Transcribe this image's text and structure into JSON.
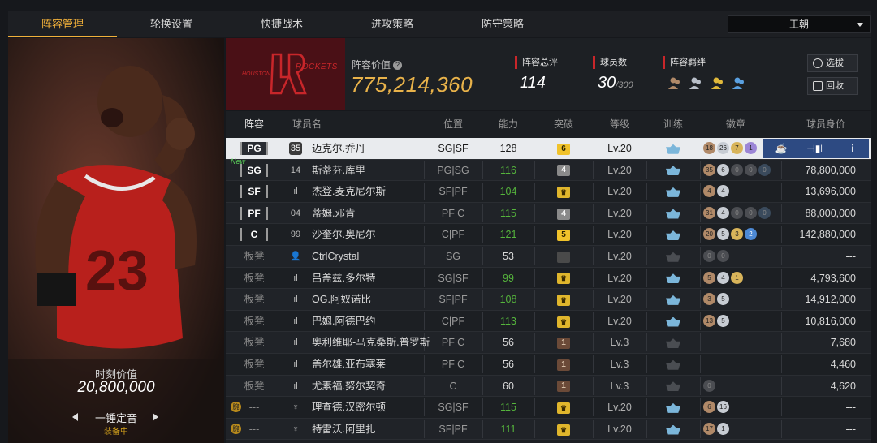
{
  "nav": {
    "tabs": [
      "阵容管理",
      "轮换设置",
      "快捷战术",
      "进攻策略",
      "防守策略"
    ],
    "active_tab": 0,
    "team_select": "王朝"
  },
  "left_panel": {
    "value_label": "时刻价值",
    "value": "20,800,000",
    "skill_name": "一锤定音",
    "skill_status": "装备中"
  },
  "header": {
    "team_logo_text": "ROCKETS",
    "lineup_value_label": "阵容价值",
    "lineup_value": "775,214,360",
    "overall_label": "阵容总评",
    "overall_value": "114",
    "player_count_label": "球员数",
    "player_count": "30",
    "player_count_max": "/300",
    "bond_label": "阵容羁绊",
    "filter_button": "选拔",
    "recycle_button": "回收"
  },
  "table": {
    "columns": [
      "阵容",
      "球员名",
      "位置",
      "能力",
      "突破",
      "等级",
      "训练",
      "徽章",
      "球员身价"
    ],
    "rows": [
      {
        "slot": "PG",
        "slot_type": "pos",
        "num": "35",
        "num_style": "hex",
        "name": "迈克尔.乔丹",
        "position": "SG|SF",
        "rating": "128",
        "rating_green": false,
        "break": "6",
        "break_style": "yellow",
        "level": "Lv.20",
        "train": true,
        "badges": [
          [
            "18",
            "b-bronze"
          ],
          [
            "26",
            "b-silver"
          ],
          [
            "7",
            "b-gold"
          ],
          [
            "1",
            "b-purple"
          ]
        ],
        "value": "",
        "selected": true
      },
      {
        "slot": "SG",
        "slot_type": "pos",
        "new": "New",
        "num": "14",
        "num_style": "plain",
        "name": "斯蒂芬.库里",
        "position": "PG|SG",
        "rating": "116",
        "rating_green": true,
        "break": "4",
        "break_style": "gray",
        "level": "Lv.20",
        "train": true,
        "badges": [
          [
            "35",
            "b-bronze"
          ],
          [
            "6",
            "b-silver"
          ],
          [
            "0",
            "b-dark"
          ],
          [
            "0",
            "b-dark"
          ],
          [
            "0",
            "b-dark2"
          ]
        ],
        "value": "78,800,000"
      },
      {
        "slot": "SF",
        "slot_type": "pos",
        "num": "ıl",
        "num_style": "plain",
        "name": "杰登.麦克尼尔斯",
        "position": "SF|PF",
        "rating": "104",
        "rating_green": true,
        "break": "♛",
        "break_style": "crown",
        "level": "Lv.20",
        "train": true,
        "badges": [
          [
            "4",
            "b-bronze"
          ],
          [
            "4",
            "b-silver"
          ]
        ],
        "value": "13,696,000"
      },
      {
        "slot": "PF",
        "slot_type": "pos",
        "num": "04",
        "num_style": "plain",
        "name": "蒂姆.邓肯",
        "position": "PF|C",
        "rating": "115",
        "rating_green": true,
        "break": "4",
        "break_style": "gray",
        "level": "Lv.20",
        "train": true,
        "badges": [
          [
            "31",
            "b-bronze"
          ],
          [
            "4",
            "b-silver"
          ],
          [
            "0",
            "b-dark"
          ],
          [
            "0",
            "b-dark"
          ],
          [
            "0",
            "b-dark2"
          ]
        ],
        "value": "88,000,000"
      },
      {
        "slot": "C",
        "slot_type": "pos",
        "num": "99",
        "num_style": "plain",
        "name": "沙奎尔.奥尼尔",
        "position": "C|PF",
        "rating": "121",
        "rating_green": true,
        "break": "5",
        "break_style": "yellow",
        "level": "Lv.20",
        "train": true,
        "badges": [
          [
            "20",
            "b-bronze"
          ],
          [
            "5",
            "b-silver"
          ],
          [
            "3",
            "b-gold"
          ],
          [
            "2",
            "b-blue"
          ]
        ],
        "value": "142,880,000"
      },
      {
        "slot": "板凳",
        "slot_type": "bench",
        "num": "👤",
        "num_style": "plain",
        "name": "CtrlCrystal",
        "position": "SG",
        "rating": "53",
        "rating_green": false,
        "break": "",
        "break_style": "dark",
        "level": "Lv.20",
        "train": false,
        "badges": [
          [
            "0",
            "b-dark"
          ],
          [
            "0",
            "b-dark"
          ]
        ],
        "value": "---"
      },
      {
        "slot": "板凳",
        "slot_type": "bench",
        "num": "ıl",
        "num_style": "plain",
        "name": "吕盖兹.多尔特",
        "position": "SG|SF",
        "rating": "99",
        "rating_green": true,
        "break": "♛",
        "break_style": "crown",
        "level": "Lv.20",
        "train": true,
        "badges": [
          [
            "5",
            "b-bronze"
          ],
          [
            "4",
            "b-silver"
          ],
          [
            "1",
            "b-gold"
          ]
        ],
        "value": "4,793,600"
      },
      {
        "slot": "板凳",
        "slot_type": "bench",
        "num": "ıl",
        "num_style": "plain",
        "name": "OG.阿奴诺比",
        "position": "SF|PF",
        "rating": "108",
        "rating_green": true,
        "break": "♛",
        "break_style": "crown",
        "level": "Lv.20",
        "train": true,
        "badges": [
          [
            "3",
            "b-bronze"
          ],
          [
            "5",
            "b-silver"
          ]
        ],
        "value": "14,912,000"
      },
      {
        "slot": "板凳",
        "slot_type": "bench",
        "num": "ıl",
        "num_style": "plain",
        "name": "巴姆.阿德巴约",
        "position": "C|PF",
        "rating": "113",
        "rating_green": true,
        "break": "♛",
        "break_style": "crown",
        "level": "Lv.20",
        "train": true,
        "badges": [
          [
            "13",
            "b-bronze"
          ],
          [
            "5",
            "b-silver"
          ]
        ],
        "value": "10,816,000"
      },
      {
        "slot": "板凳",
        "slot_type": "bench",
        "num": "ıl",
        "num_style": "plain",
        "name": "奥利维耶-马克桑斯.普罗斯",
        "position": "PF|C",
        "rating": "56",
        "rating_green": false,
        "break": "1",
        "break_style": "brown",
        "level": "Lv.3",
        "train": false,
        "badges": [],
        "value": "7,680"
      },
      {
        "slot": "板凳",
        "slot_type": "bench",
        "num": "ıl",
        "num_style": "plain",
        "name": "盖尔雄.亚布塞莱",
        "position": "PF|C",
        "rating": "56",
        "rating_green": false,
        "break": "1",
        "break_style": "brown",
        "level": "Lv.3",
        "train": false,
        "badges": [],
        "value": "4,460"
      },
      {
        "slot": "板凳",
        "slot_type": "bench",
        "num": "ıl",
        "num_style": "plain",
        "name": "尤素福.努尔契奇",
        "position": "C",
        "rating": "60",
        "rating_green": false,
        "break": "1",
        "break_style": "brown",
        "level": "Lv.3",
        "train": false,
        "badges": [
          [
            "0",
            "b-dark"
          ]
        ],
        "value": "4,620"
      },
      {
        "slot": "---",
        "slot_type": "coin",
        "num": "♆",
        "num_style": "plain",
        "name": "理查德.汉密尔顿",
        "position": "SG|SF",
        "rating": "115",
        "rating_green": true,
        "break": "♛",
        "break_style": "crown",
        "level": "Lv.20",
        "train": true,
        "badges": [
          [
            "6",
            "b-bronze"
          ],
          [
            "16",
            "b-silver"
          ]
        ],
        "value": "---"
      },
      {
        "slot": "---",
        "slot_type": "coin",
        "num": "♆",
        "num_style": "plain",
        "name": "特雷沃.阿里扎",
        "position": "SF|PF",
        "rating": "111",
        "rating_green": true,
        "break": "♛",
        "break_style": "crown",
        "level": "Lv.20",
        "train": true,
        "badges": [
          [
            "17",
            "b-bronze"
          ],
          [
            "1",
            "b-silver"
          ]
        ],
        "value": "---"
      }
    ]
  },
  "coin_glyph": "腕"
}
